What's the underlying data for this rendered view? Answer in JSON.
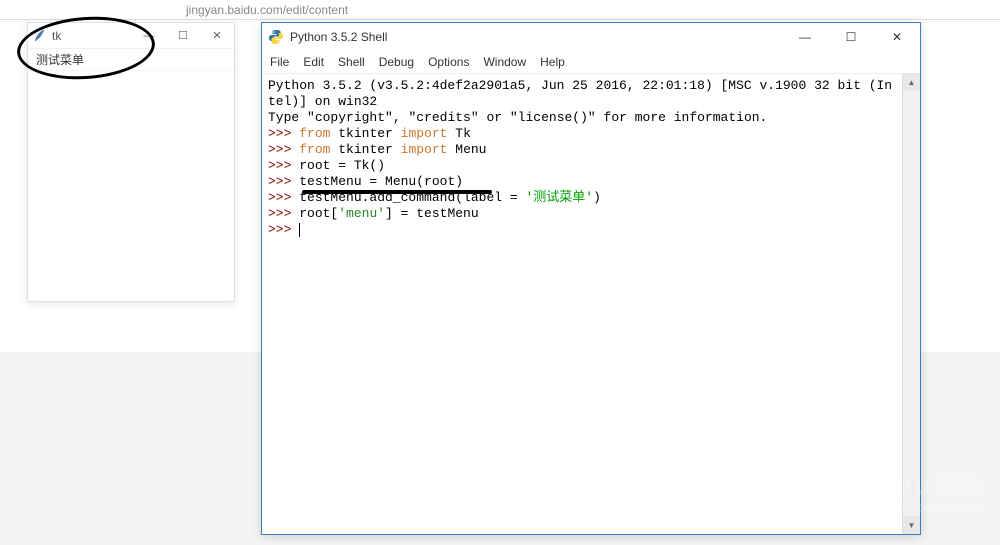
{
  "browser": {
    "url": "jingyan.baidu.com/edit/content"
  },
  "tk": {
    "title": "tk",
    "menu_item": "测试菜单",
    "min": "—",
    "max": "☐",
    "close": "✕"
  },
  "shell": {
    "title": "Python 3.5.2 Shell",
    "menu": {
      "file": "File",
      "edit": "Edit",
      "shell": "Shell",
      "debug": "Debug",
      "options": "Options",
      "window": "Window",
      "help": "Help"
    },
    "min": "—",
    "max": "☐",
    "close": "✕",
    "banner1": "Python 3.5.2 (v3.5.2:4def2a2901a5, Jun 25 2016, 22:01:18) [MSC v.1900 32 bit (In",
    "banner2": "tel)] on win32",
    "banner3_a": "Type ",
    "banner3_b": "\"copyright\"",
    "banner3_c": ", ",
    "banner3_d": "\"credits\"",
    "banner3_e": " or ",
    "banner3_f": "\"license()\"",
    "banner3_g": " for more information.",
    "prompt": ">>> ",
    "line1_a": "from",
    "line1_b": " tkinter ",
    "line1_c": "import",
    "line1_d": " Tk",
    "line2_a": "from",
    "line2_b": " tkinter ",
    "line2_c": "import",
    "line2_d": " Menu",
    "line3": "root = Tk()",
    "line4": "testMenu = Menu(root)",
    "line5_a": "testMenu.add_command(label = ",
    "line5_b": "'测试菜单'",
    "line5_c": ")",
    "line6_a": "root[",
    "line6_b": "'menu'",
    "line6_c": "] = testMenu",
    "scroll_up": "▲",
    "scroll_down": "▼"
  },
  "watermark": {
    "main": "Baidu",
    "cn": "经验",
    "sub": "jingyan.baidu.com"
  }
}
